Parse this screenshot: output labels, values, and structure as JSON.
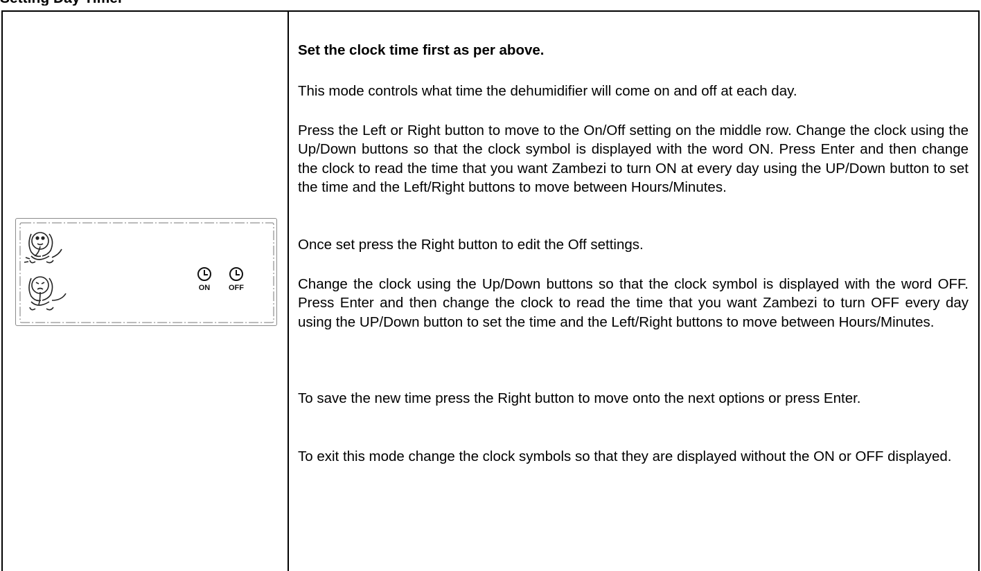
{
  "header": {
    "section_title": "Setting Day Timer"
  },
  "lcd": {
    "clock_on_label": "ON",
    "clock_off_label": "OFF",
    "icons": [
      "elephant-happy-icon",
      "elephant-sad-icon",
      "clock-icon"
    ]
  },
  "content": {
    "p1": "Set the clock time first as per above.",
    "p2": "This mode controls what time the dehumidifier will come on and off at each day.",
    "p3": "Press the Left or Right button to move to the On/Off setting on the middle row. Change the clock using the Up/Down buttons so that the clock symbol is displayed with the word ON.  Press Enter and then change the clock to read the time that you want Zambezi to turn ON at every day using the UP/Down button to set the time and the Left/Right buttons to move between Hours/Minutes.",
    "p4": "Once set press the Right button to edit the Off settings.",
    "p5": "Change the clock using the Up/Down buttons so that the clock symbol is displayed with the word OFF.  Press Enter and then change the clock to read the time that you want Zambezi to turn OFF every day using the UP/Down button to set the time and the Left/Right buttons to move between Hours/Minutes.",
    "p6": "To save the new time press the Right button to move onto the next options or press Enter.",
    "p7": "To exit this mode change the clock symbols so that they are displayed without the ON or OFF displayed."
  }
}
